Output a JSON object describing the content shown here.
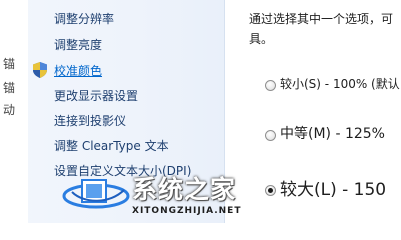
{
  "sidebar": {
    "edge_chars": [
      "锚",
      "锚",
      "动"
    ],
    "tasks": [
      {
        "label": "调整分辨率"
      },
      {
        "label": "调整亮度"
      },
      {
        "label": "校准颜色"
      },
      {
        "label": "更改显示器设置"
      },
      {
        "label": "连接到投影仪"
      },
      {
        "label": "调整 ClearType 文本"
      },
      {
        "label": "设置自定义文本大小(DPI)"
      }
    ]
  },
  "main": {
    "intro": "通过选择其中一个选项，可具。",
    "options": [
      {
        "label": "较小(S) - 100% (默认",
        "checked": false
      },
      {
        "label": "中等(M) - 125%",
        "checked": false
      },
      {
        "label": "较大(L) - 150",
        "checked": true
      }
    ]
  },
  "watermark": {
    "title": "系统之家",
    "domain": "XITONGZHIJIA.NET"
  },
  "colors": {
    "link": "#1e3f6f",
    "active_link": "#0066cc",
    "sidebar_bg": "#eef3fb"
  },
  "icons": {
    "calibrate": "uac-shield-icon"
  }
}
